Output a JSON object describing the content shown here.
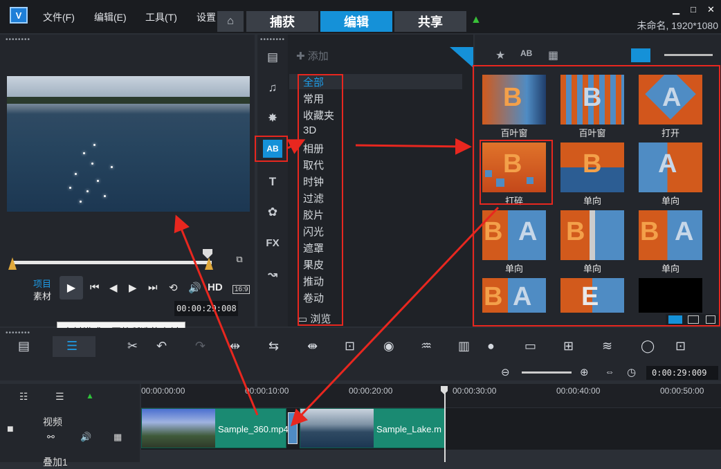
{
  "app": {
    "title": "未命名, 1920*1080",
    "menus": [
      "文件(F)",
      "编辑(E)",
      "工具(T)",
      "设置"
    ]
  },
  "tabs": [
    {
      "label": "捕获"
    },
    {
      "label": "编辑"
    },
    {
      "label": "共享"
    }
  ],
  "window": {
    "minimize": "▁",
    "close": "✕",
    "restore": "□"
  },
  "preview": {
    "mode_project": "项目",
    "mode_clip": "素材",
    "timecode": "00:00:29:008",
    "hd": "HD",
    "aspect": "16:9",
    "tooltip": "素材模式：回放所选的素材"
  },
  "library": {
    "add_label": "添加",
    "browse_label": "浏览",
    "categories": [
      "全部",
      "常用",
      "收藏夹",
      "3D",
      "相册",
      "取代",
      "时钟",
      "过滤",
      "胶片",
      "闪光",
      "遮罩",
      "果皮",
      "推动",
      "卷动"
    ]
  },
  "transitions": [
    {
      "label": "百叶窗"
    },
    {
      "label": "百叶窗"
    },
    {
      "label": "打开"
    },
    {
      "label": "打碎"
    },
    {
      "label": "单向"
    },
    {
      "label": "单向"
    },
    {
      "label": "单向"
    },
    {
      "label": "单向"
    },
    {
      "label": "单向"
    },
    {
      "label": ""
    },
    {
      "label": ""
    },
    {
      "label": ""
    }
  ],
  "timeline": {
    "timecode": "0:00:29:009",
    "ruler": [
      "00:00:00:00",
      "00:00:10:00",
      "00:00:20:00",
      "00:00:30:00",
      "00:00:40:00",
      "00:00:50:00"
    ],
    "track_video": "视频",
    "track_overlay": "叠加1",
    "clip1": "Sample_360.mp4",
    "clip2": "Sample_Lake.m"
  },
  "colors": {
    "accent": "#1591d8",
    "highlight": "#e8271f",
    "clip": "#1a8a72"
  }
}
